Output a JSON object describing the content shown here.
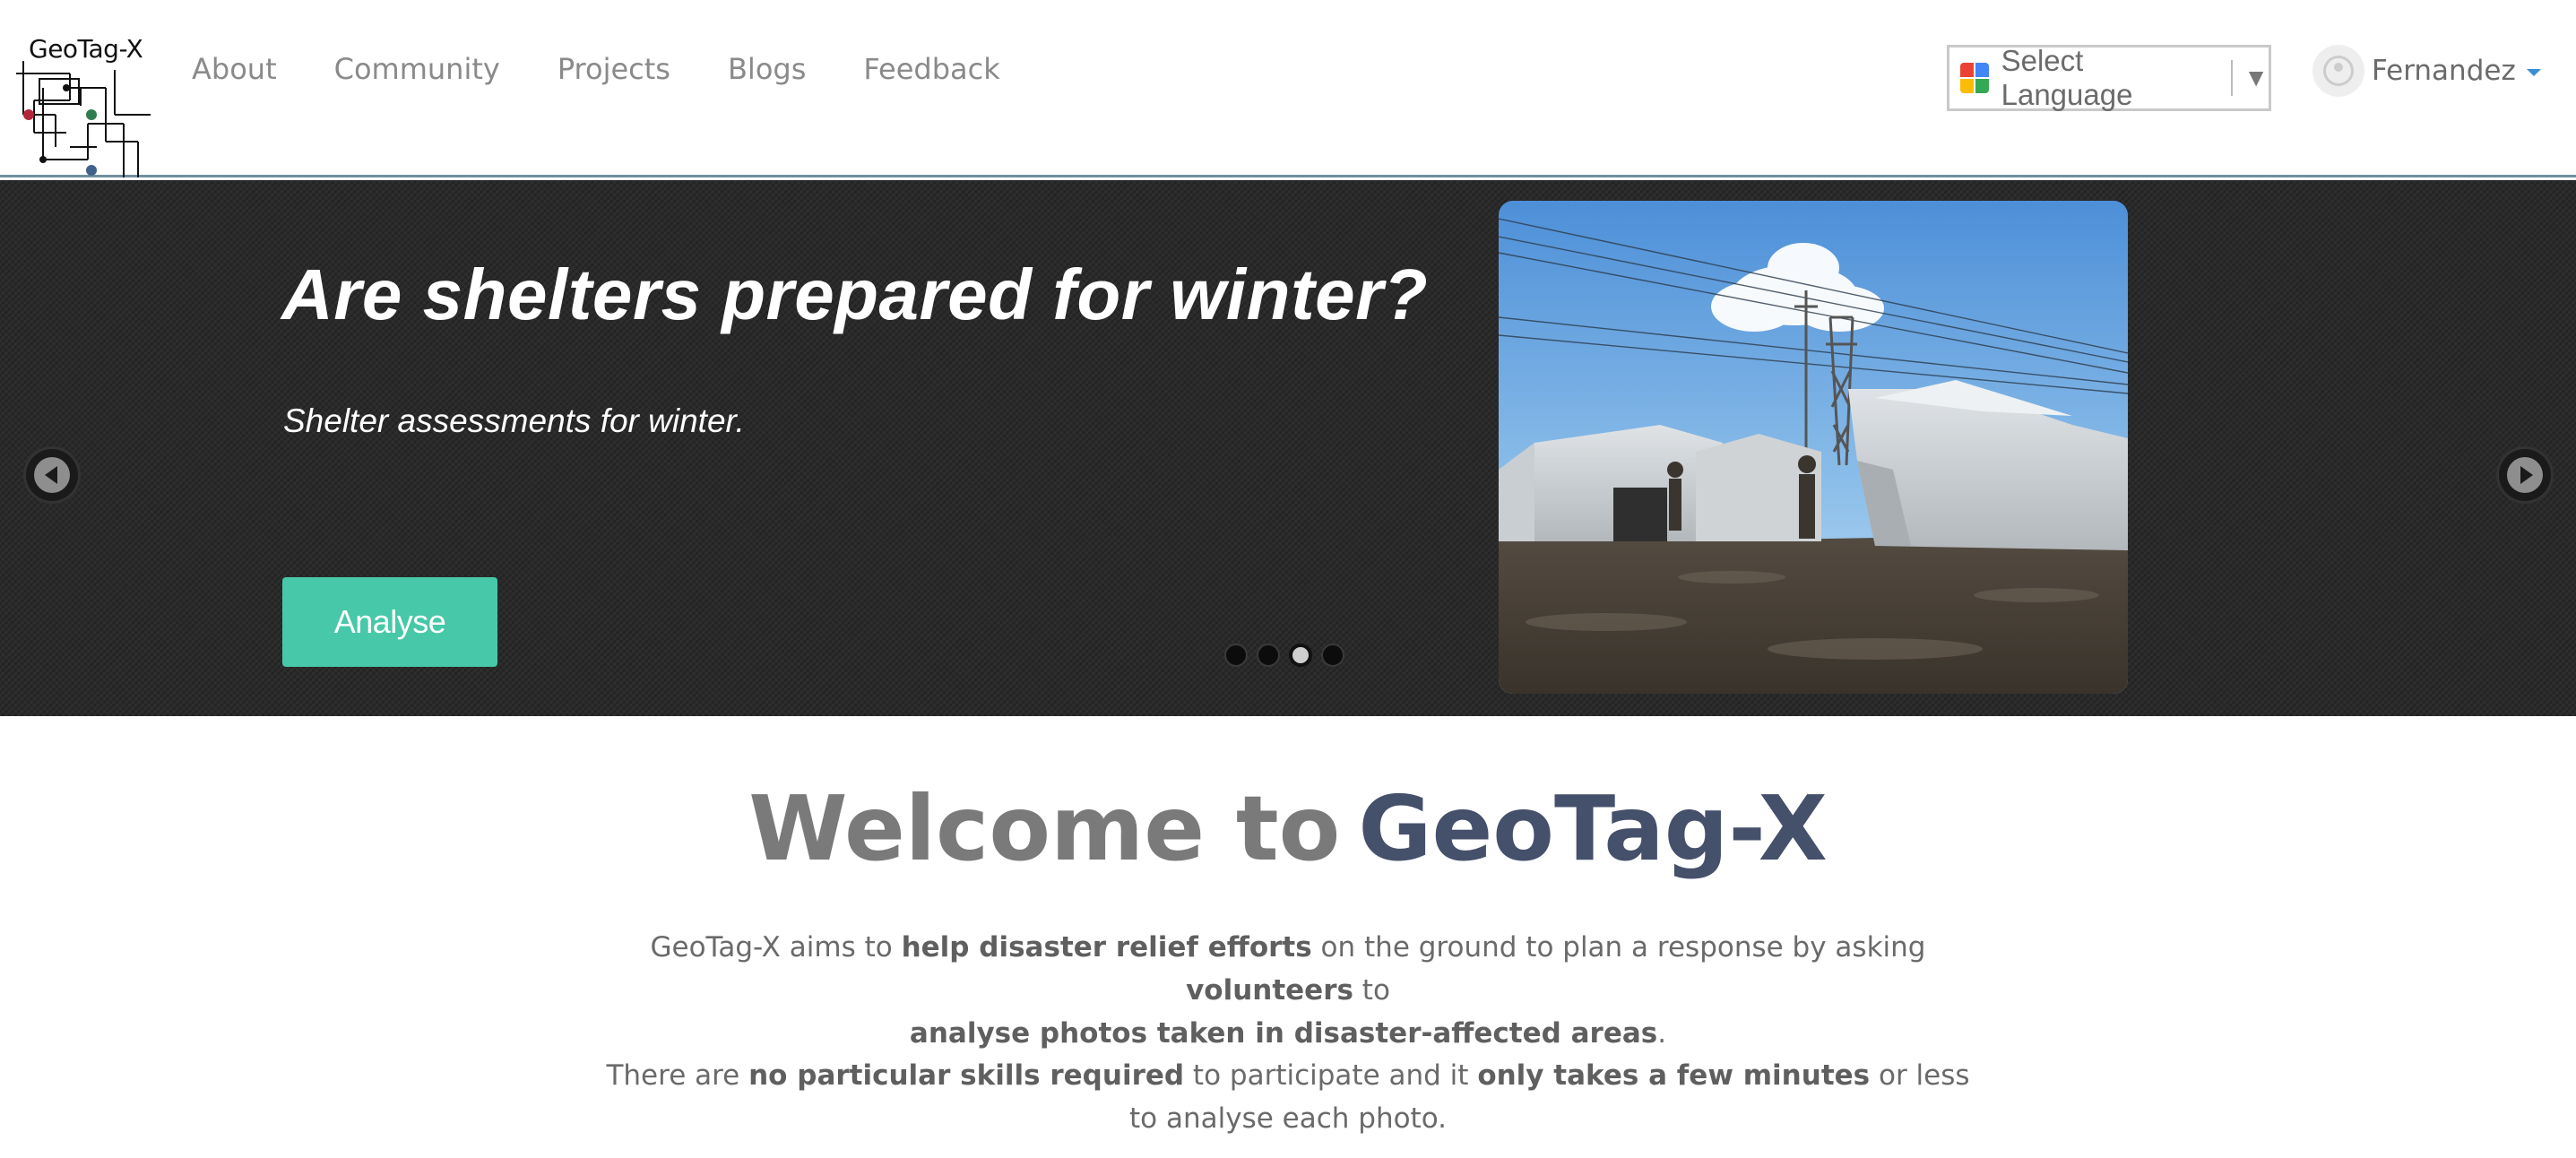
{
  "header": {
    "logo_text": "GeoTag-X",
    "nav": [
      "About",
      "Community",
      "Projects",
      "Blogs",
      "Feedback"
    ],
    "language_select": {
      "label": "Select Language",
      "arrow": "▼",
      "icon": "google-translate-icon"
    },
    "user": {
      "name": "Fernandez",
      "icon": "user-avatar-icon"
    }
  },
  "carousel": {
    "title": "Are shelters prepared for winter?",
    "subtitle": "Shelter assessments for winter.",
    "button_label": "Analyse",
    "slide_count": 4,
    "active_slide": 3,
    "image": "tents-in-muddy-camp-photo",
    "prev_icon": "arrow-left-icon",
    "next_icon": "arrow-right-icon",
    "colors": {
      "button": "#47c8a8",
      "background": "#2a2a2a"
    }
  },
  "welcome": {
    "prefix": "Welcome to",
    "brand": "GeoTag-X",
    "colors": {
      "prefix": "#7a7a7a",
      "brand": "#45506b"
    }
  },
  "intro": {
    "p1": [
      {
        "t": "GeoTag-X aims to ",
        "b": false
      },
      {
        "t": "help disaster relief efforts",
        "b": true
      },
      {
        "t": " on the ground to plan a response by asking ",
        "b": false
      },
      {
        "t": "volunteers",
        "b": true
      },
      {
        "t": " to ",
        "b": false
      },
      {
        "t": "analyse photos taken in disaster-affected areas",
        "b": true
      },
      {
        "t": ".",
        "b": false
      }
    ],
    "p2": [
      {
        "t": "There are ",
        "b": false
      },
      {
        "t": "no particular skills required",
        "b": true
      },
      {
        "t": " to participate and it ",
        "b": false
      },
      {
        "t": "only takes a few minutes",
        "b": true
      },
      {
        "t": " or less to analyse each photo.",
        "b": false
      }
    ]
  }
}
